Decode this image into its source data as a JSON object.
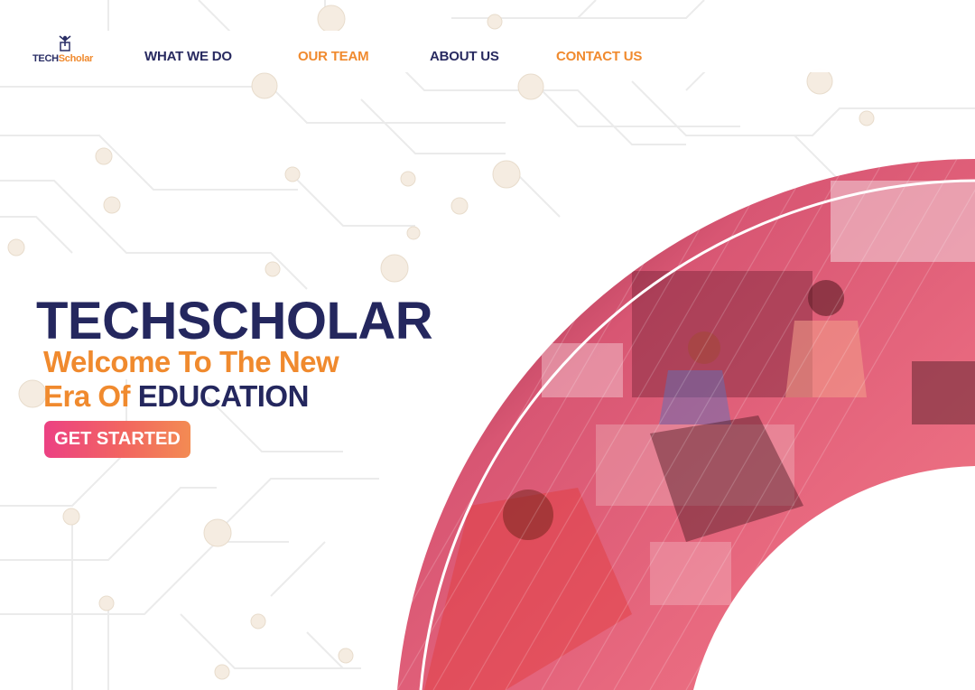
{
  "brand": {
    "logo_part1": "TECH",
    "logo_part2": "Scholar"
  },
  "nav": {
    "items": [
      {
        "label": "WHAT WE DO"
      },
      {
        "label": "OUR TEAM"
      },
      {
        "label": "ABOUT US"
      },
      {
        "label": "CONTACT US"
      }
    ]
  },
  "hero": {
    "title": "TECHSCHOLAR",
    "subtitle_line1": "Welcome To The New",
    "subtitle_line2_prefix": "Era Of ",
    "subtitle_line2_accent": "EDUCATION",
    "cta_label": "GET STARTED"
  },
  "colors": {
    "navy": "#24275e",
    "orange": "#f08a2e",
    "cta_gradient_start": "#ec4183",
    "cta_gradient_end": "#f38b53",
    "overlay_pink": "#e0607a",
    "overlay_maroon": "#8e2438"
  },
  "icons": {
    "logo": "graduate-figure-icon"
  }
}
